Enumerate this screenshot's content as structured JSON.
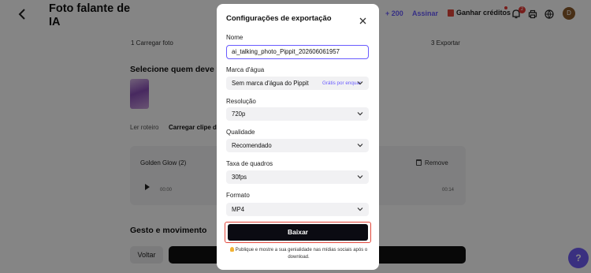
{
  "page": {
    "title": "Foto falante de IA",
    "credits_button": "+ 200",
    "subscribe_button": "Assinar",
    "earn_credits": "Ganhar créditos",
    "notifications_count": "2",
    "avatar_initial": "D",
    "step1": "1  Carregar foto",
    "step3": "3  Exportar",
    "select_heading": "Selecione quem deve fa",
    "tab_script": "Ler roteiro",
    "tab_clip": "Carregar clipe de",
    "audio_name": "Golden Glow (2)",
    "remove_label": "Remove",
    "time_start": "00:00",
    "time_end": "00:14",
    "gesture_heading": "Gesto e movimento",
    "back_button": "Voltar",
    "help_icon": "?"
  },
  "modal": {
    "title": "Configurações de exportação",
    "name_label": "Nome",
    "name_value": "ai_talking_photo_Pippit_202606061957",
    "watermark_label": "Marca d'água",
    "watermark_value": "Sem marca d'água do Pippit",
    "watermark_badge": "Grátis por enquar",
    "resolution_label": "Resolução",
    "resolution_value": "720p",
    "quality_label": "Qualidade",
    "quality_value": "Recomendado",
    "framerate_label": "Taxa de quadros",
    "framerate_value": "30fps",
    "format_label": "Formato",
    "format_value": "MP4",
    "download_button": "Baixar",
    "tip": "Publique e mostre a sua genialidade nas mídias sociais após o download."
  },
  "colors": {
    "accent": "#6a5cff",
    "highlight_outline": "#e2463a",
    "primary_button": "#0b0b12"
  }
}
